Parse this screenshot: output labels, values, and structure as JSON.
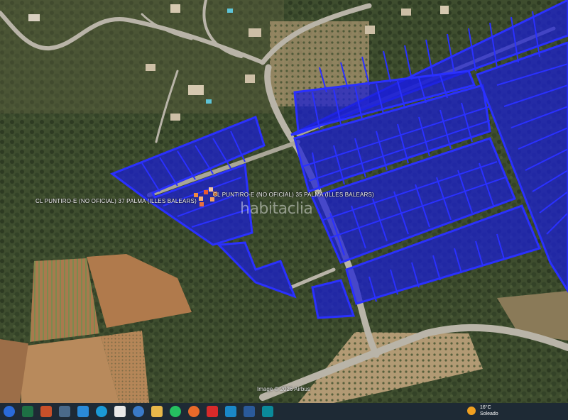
{
  "map": {
    "labels": {
      "left": "CL PUNTIRO-E (NO OFICIAL) 37 PALMA (ILLES BALEARS)",
      "right": "CL PUNTIRO-E (NO OFICIAL) 35 PALMA (ILLES BALEARS)"
    },
    "watermark": "habitaclia",
    "imagery_credit": "Image © 2026 Airbus",
    "colors": {
      "parcel_fill": "#1a1fd6",
      "parcel_stroke": "#2a30ff",
      "road": "#b9b4a8",
      "marker": "#f08a40"
    }
  },
  "taskbar": {
    "icons": [
      "chrome-icon",
      "excel-icon",
      "presentation-icon",
      "app-icon",
      "photos-icon",
      "edge-icon",
      "file-icon",
      "globe-icon",
      "folder-icon",
      "whatsapp-icon",
      "firefox-icon",
      "acrobat-icon",
      "sway-icon",
      "calendar-icon",
      "settings-icon"
    ],
    "weather": {
      "temp": "16°C",
      "condition": "Soleado"
    }
  }
}
